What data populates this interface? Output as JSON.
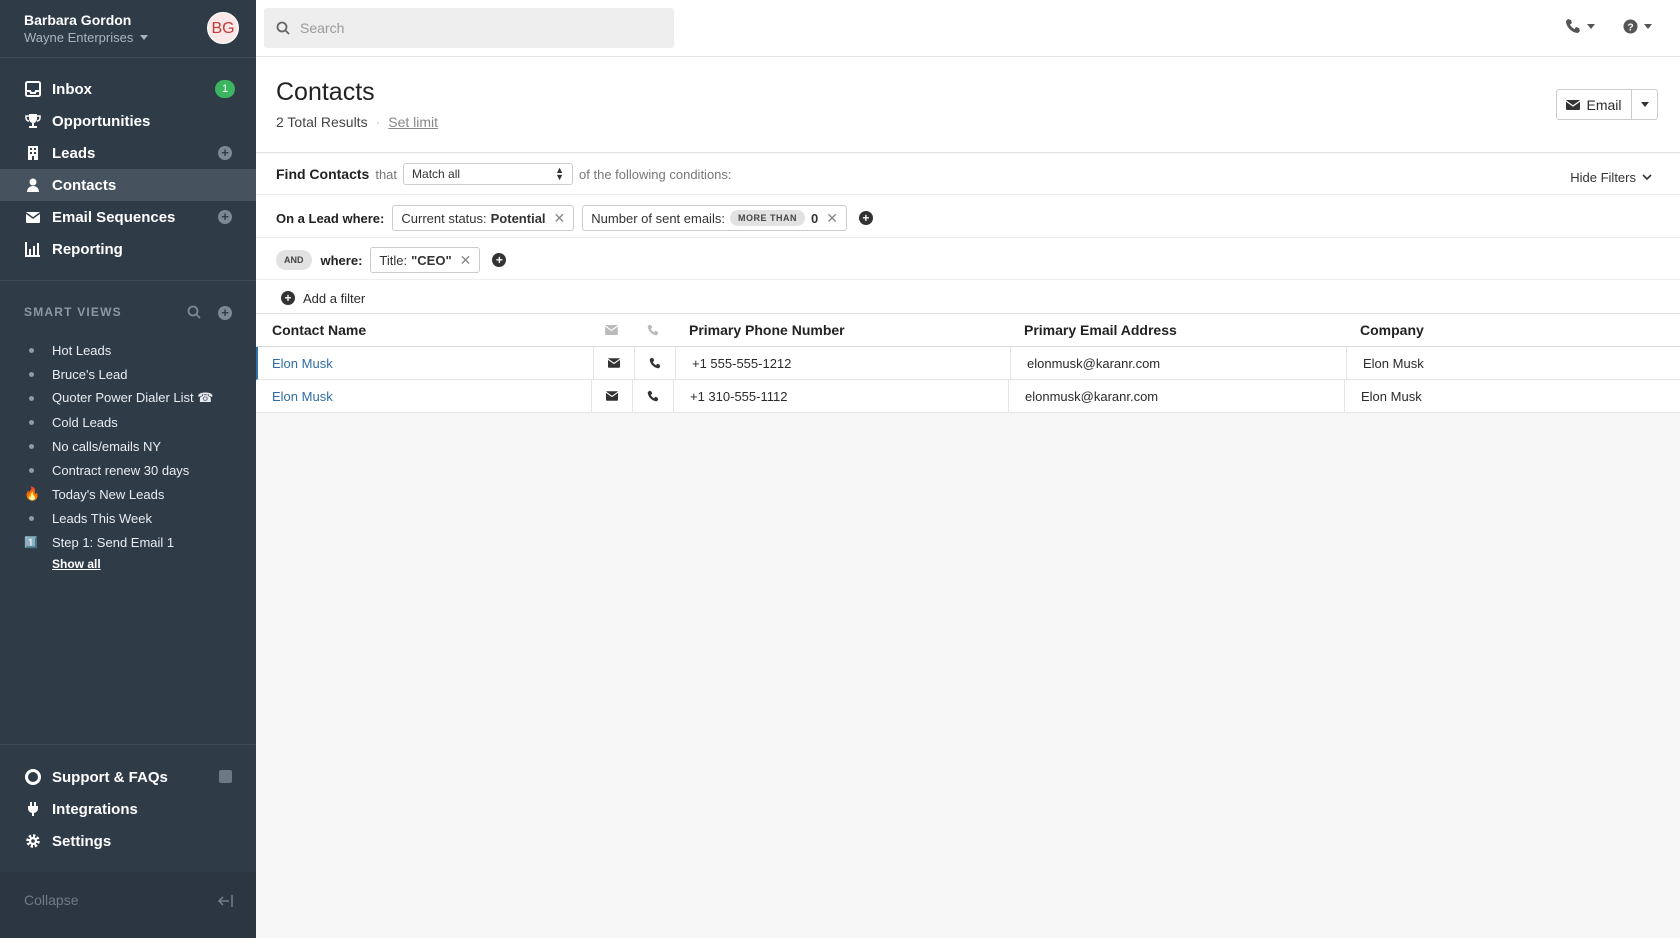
{
  "user": {
    "name": "Barbara Gordon",
    "org": "Wayne Enterprises",
    "initials": "BG"
  },
  "nav": [
    {
      "label": "Inbox",
      "badge": "1"
    },
    {
      "label": "Opportunities"
    },
    {
      "label": "Leads"
    },
    {
      "label": "Contacts"
    },
    {
      "label": "Email Sequences"
    },
    {
      "label": "Reporting"
    }
  ],
  "smart_views": {
    "heading": "SMART VIEWS",
    "items": [
      {
        "label": "Hot Leads"
      },
      {
        "label": "Bruce's Lead"
      },
      {
        "label": "Quoter Power Dialer List ☎"
      },
      {
        "label": "Cold Leads"
      },
      {
        "label": "No calls/emails NY"
      },
      {
        "label": "Contract renew 30 days"
      },
      {
        "label": "Today's New Leads",
        "icon": "🔥"
      },
      {
        "label": "Leads This Week"
      },
      {
        "label": "Step 1: Send Email 1",
        "icon": "1️⃣"
      }
    ],
    "show_all": "Show all"
  },
  "bottom_nav": [
    {
      "label": "Support & FAQs"
    },
    {
      "label": "Integrations"
    },
    {
      "label": "Settings"
    }
  ],
  "collapse_label": "Collapse",
  "search": {
    "placeholder": "Search"
  },
  "page": {
    "title": "Contacts",
    "results": "2 Total Results",
    "set_limit": "Set limit",
    "email_button": "Email"
  },
  "filters": {
    "find_label": "Find Contacts",
    "that": "that",
    "match": "Match all",
    "conditions": "of the following conditions:",
    "hide_filters": "Hide Filters",
    "lead_where": "On a Lead where:",
    "chip1_label": "Current status:",
    "chip1_value": "Potential",
    "chip2_label": "Number of sent emails:",
    "chip2_op": "MORE THAN",
    "chip2_value": "0",
    "and": "AND",
    "where": "where:",
    "chip3_label": "Title:",
    "chip3_value": "\"CEO\"",
    "add_filter": "Add a filter"
  },
  "table": {
    "columns": [
      "Contact Name",
      "Primary Phone Number",
      "Primary Email Address",
      "Company"
    ],
    "rows": [
      {
        "name": "Elon Musk",
        "phone": "+1 555-555-1212",
        "email": "elonmusk@karanr.com",
        "company": "Elon Musk"
      },
      {
        "name": "Elon Musk",
        "phone": "+1 310-555-1112",
        "email": "elonmusk@karanr.com",
        "company": "Elon Musk"
      }
    ]
  },
  "colors": {
    "sidebar": "#2f3b47",
    "link": "#2e6ea6",
    "badge": "#3bb55f"
  }
}
